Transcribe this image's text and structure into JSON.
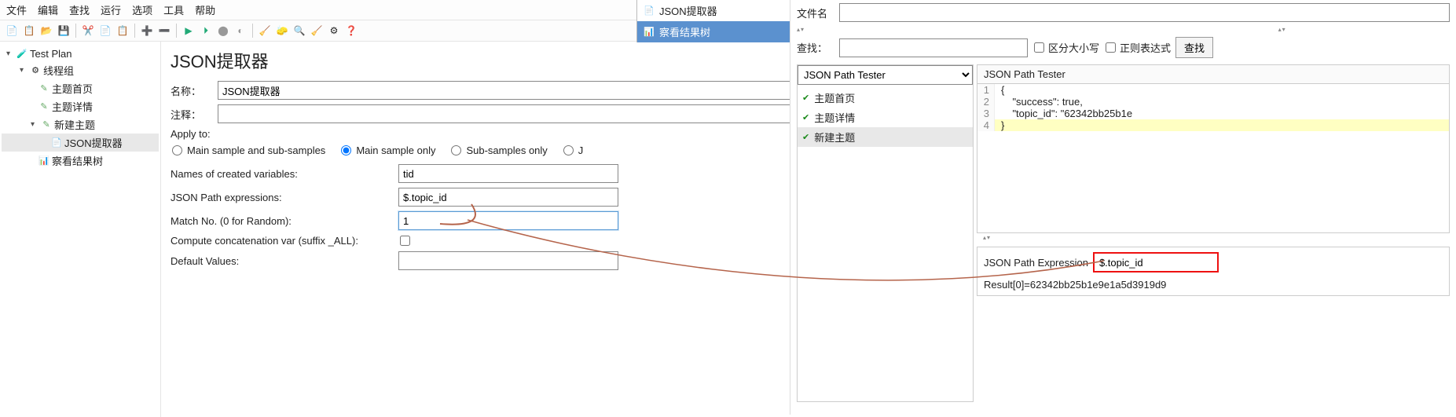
{
  "menu": {
    "file": "文件",
    "edit": "编辑",
    "search": "查找",
    "run": "运行",
    "options": "选项",
    "tools": "工具",
    "help": "帮助"
  },
  "tree": {
    "root": "Test Plan",
    "tg": "线程组",
    "s1": "主题首页",
    "s2": "主题详情",
    "np": "新建主题",
    "jx": "JSON提取器",
    "rt": "察看结果树"
  },
  "form": {
    "title": "JSON提取器",
    "name_label": "名称：",
    "name_value": "JSON提取器",
    "comment_label": "注释：",
    "comment_value": "",
    "apply_label": "Apply to:",
    "r1": "Main sample and sub-samples",
    "r2": "Main sample only",
    "r3": "Sub-samples only",
    "r4": "J",
    "vars_label": "Names of created variables:",
    "vars_value": "tid",
    "path_label": "JSON Path expressions:",
    "path_value": "$.topic_id",
    "match_label": "Match No. (0 for Random):",
    "match_value": "1",
    "concat_label": "Compute concatenation var (suffix _ALL):",
    "default_label": "Default Values:",
    "default_value": ""
  },
  "overlay": {
    "jx": "JSON提取器",
    "rt": "察看结果树"
  },
  "rp": {
    "filename_label": "文件名",
    "find_label": "查找：",
    "case": "区分大小写",
    "regex": "正则表达式",
    "find_btn": "查找",
    "tester": "JSON Path Tester",
    "li1": "主题首页",
    "li2": "主题详情",
    "li3": "新建主题",
    "tabhead": "JSON Path Tester",
    "code": {
      "l1": "{",
      "l2": "    \"success\": true,",
      "l3": "    \"topic_id\": \"62342bb25b1e",
      "l4": "}"
    },
    "jpe_label": "JSON Path Expression",
    "jpe_value": "$.topic_id",
    "result": "Result[0]=62342bb25b1e9e1a5d3919d9"
  }
}
